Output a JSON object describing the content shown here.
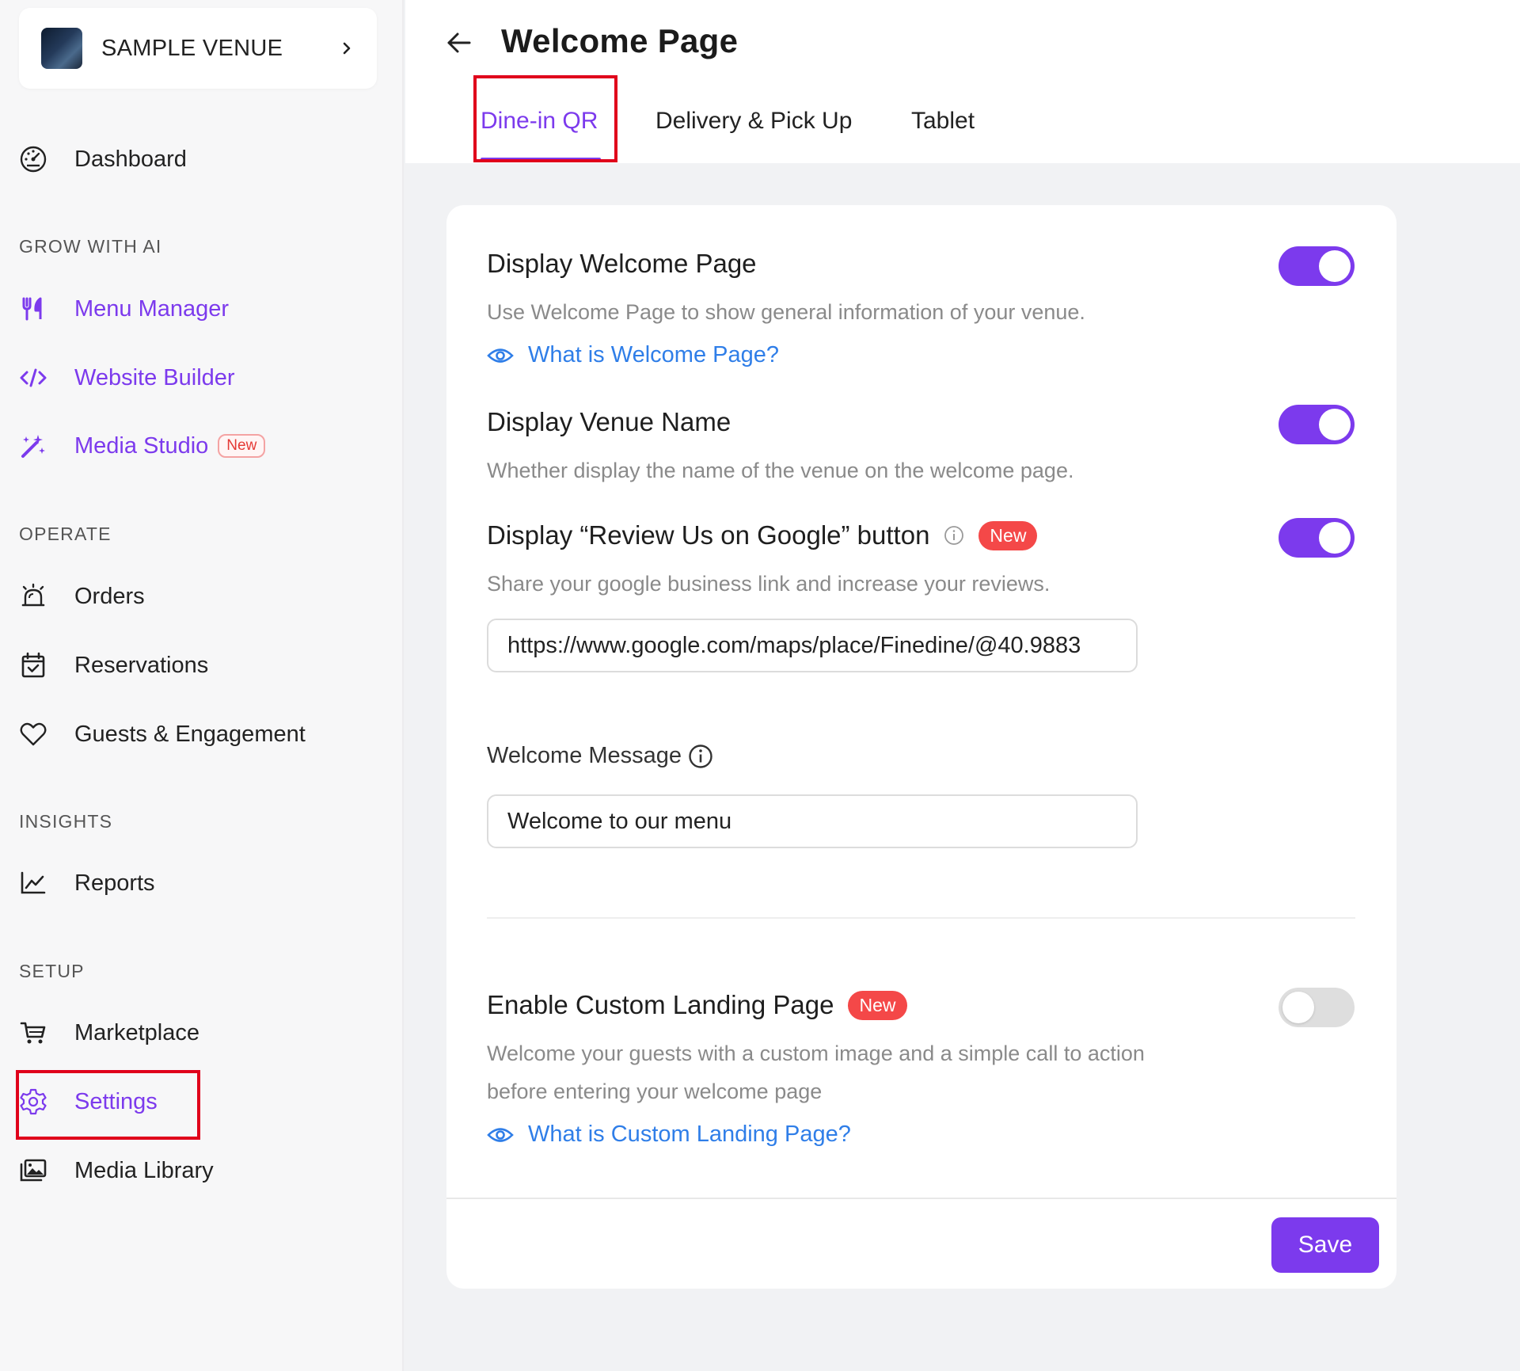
{
  "colors": {
    "accent": "#7c3aed",
    "link": "#2f7ee8",
    "badge_red": "#f44848",
    "highlight": "#e0001b"
  },
  "sidebar": {
    "venue": {
      "name": "SAMPLE VENUE",
      "chevron_icon": "chevron-right-icon"
    },
    "dashboard": {
      "label": "Dashboard",
      "icon": "speedometer-icon"
    },
    "sections": {
      "grow": "GROW WITH AI",
      "operate": "OPERATE",
      "insights": "INSIGHTS",
      "setup": "SETUP"
    },
    "grow_items": [
      {
        "label": "Menu Manager",
        "icon": "fork-knife-icon"
      },
      {
        "label": "Website Builder",
        "icon": "code-icon"
      },
      {
        "label": "Media Studio",
        "icon": "magic-wand-icon",
        "badge": "New"
      }
    ],
    "operate_items": [
      {
        "label": "Orders",
        "icon": "bell-alarm-icon"
      },
      {
        "label": "Reservations",
        "icon": "calendar-check-icon"
      },
      {
        "label": "Guests & Engagement",
        "icon": "heart-icon"
      }
    ],
    "insights_items": [
      {
        "label": "Reports",
        "icon": "line-chart-icon"
      }
    ],
    "setup_items": [
      {
        "label": "Marketplace",
        "icon": "cart-icon"
      },
      {
        "label": "Settings",
        "icon": "gear-icon",
        "active": true
      },
      {
        "label": "Media Library",
        "icon": "images-icon"
      }
    ]
  },
  "header": {
    "back_icon": "arrow-left-icon",
    "title": "Welcome Page",
    "tabs": [
      {
        "label": "Dine-in QR",
        "active": true
      },
      {
        "label": "Delivery & Pick Up"
      },
      {
        "label": "Tablet"
      }
    ]
  },
  "settings": {
    "welcome_page": {
      "title": "Display Welcome Page",
      "description": "Use Welcome Page to show general information of your venue.",
      "link": "What is Welcome Page?",
      "enabled": true
    },
    "venue_name": {
      "title": "Display Venue Name",
      "description": "Whether display the name of the venue on the welcome page.",
      "enabled": true
    },
    "review_google": {
      "title": "Display “Review Us on Google” button",
      "badge": "New",
      "description": "Share your google business link and increase your reviews.",
      "url_value": "https://www.google.com/maps/place/Finedine/@40.9883",
      "enabled": true
    },
    "welcome_message": {
      "label": "Welcome Message",
      "value": "Welcome to our menu"
    },
    "custom_landing": {
      "title": "Enable Custom Landing Page",
      "badge": "New",
      "description_line1": "Welcome your guests with a custom image and a simple call to action",
      "description_line2": "before entering your welcome page",
      "link": "What is Custom Landing Page?",
      "enabled": false
    }
  },
  "footer": {
    "save_label": "Save"
  }
}
